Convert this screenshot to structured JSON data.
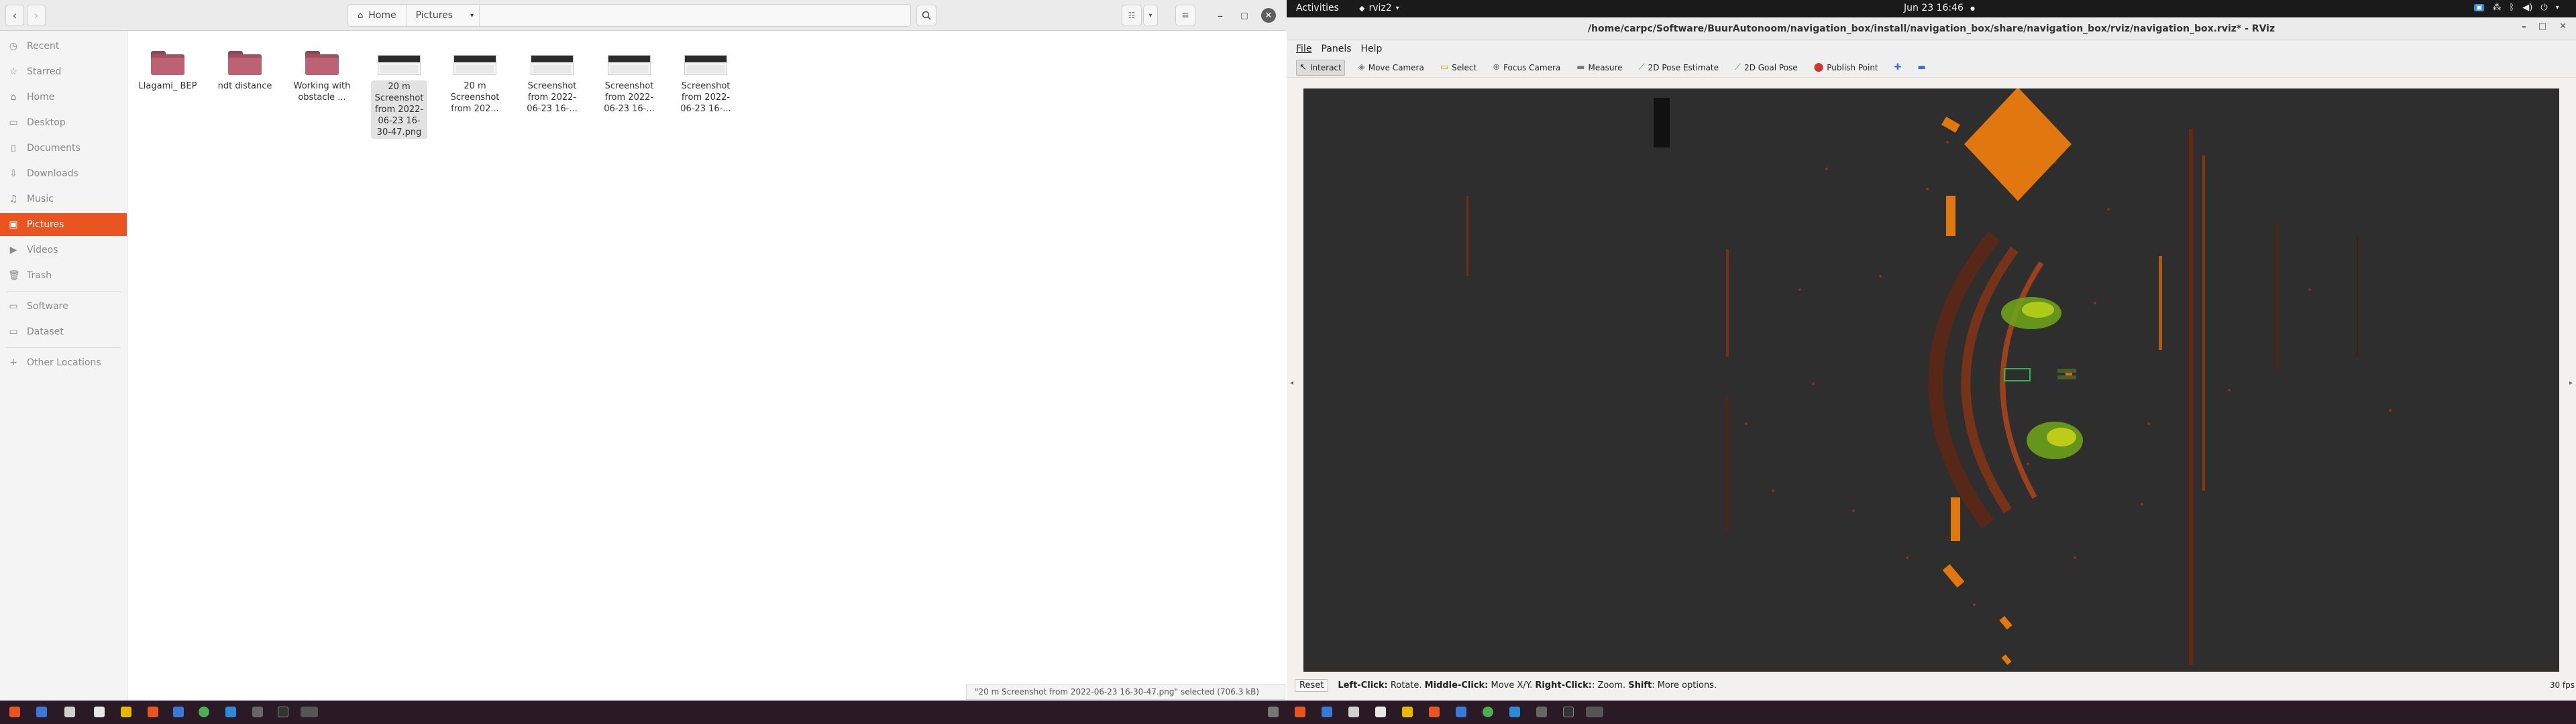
{
  "file_manager": {
    "nav": {
      "back": "‹",
      "forward": "›"
    },
    "path": [
      "Home",
      "Pictures"
    ],
    "sidebar": [
      {
        "label": "Recent",
        "icon": "clock-icon"
      },
      {
        "label": "Starred",
        "icon": "star-icon"
      },
      {
        "label": "Home",
        "icon": "home-icon"
      },
      {
        "label": "Desktop",
        "icon": "desktop-icon"
      },
      {
        "label": "Documents",
        "icon": "document-icon"
      },
      {
        "label": "Downloads",
        "icon": "download-icon"
      },
      {
        "label": "Music",
        "icon": "music-icon"
      },
      {
        "label": "Pictures",
        "icon": "picture-icon",
        "active": true
      },
      {
        "label": "Videos",
        "icon": "video-icon"
      },
      {
        "label": "Trash",
        "icon": "trash-icon"
      },
      {
        "label": "Software",
        "icon": "folder-icon"
      },
      {
        "label": "Dataset",
        "icon": "folder-icon"
      },
      {
        "label": "Other Locations",
        "icon": "plus-icon"
      }
    ],
    "files": [
      {
        "name": "Llagami_ BEP",
        "kind": "folder"
      },
      {
        "name": "ndt distance",
        "kind": "folder"
      },
      {
        "name": "Working with obstacle ...",
        "kind": "folder"
      },
      {
        "name": "20 m Screenshot from 2022-06-23 16-30-47.png",
        "kind": "image",
        "selected": true
      },
      {
        "name": "20 m Screenshot from 202...",
        "kind": "image"
      },
      {
        "name": "Screenshot from 2022-06-23 16-...",
        "kind": "image"
      },
      {
        "name": "Screenshot from 2022-06-23 16-...",
        "kind": "image"
      },
      {
        "name": "Screenshot from 2022-06-23 16-...",
        "kind": "image"
      }
    ],
    "status": "\"20 m Screenshot from 2022-06-23 16-30-47.png\" selected (706.3 kB)"
  },
  "topbar": {
    "activities": "Activities",
    "app": "rviz2",
    "clock": "Jun 23  16:46"
  },
  "rviz": {
    "title": "/home/carpc/Software/BuurAutonoom/navigation_box/install/navigation_box/share/navigation_box/rviz/navigation_box.rviz* - RViz",
    "menu": [
      "File",
      "Panels",
      "Help"
    ],
    "tools": [
      {
        "label": "Interact",
        "icon": "cursor-icon",
        "active": true
      },
      {
        "label": "Move Camera",
        "icon": "camera-move-icon"
      },
      {
        "label": "Select",
        "icon": "select-icon"
      },
      {
        "label": "Focus Camera",
        "icon": "focus-icon"
      },
      {
        "label": "Measure",
        "icon": "ruler-icon"
      },
      {
        "label": "2D Pose Estimate",
        "icon": "pose-estimate-icon"
      },
      {
        "label": "2D Goal Pose",
        "icon": "goal-pose-icon"
      },
      {
        "label": "Publish Point",
        "icon": "publish-point-icon"
      }
    ],
    "status": {
      "reset": "Reset",
      "hint_left_key": "Left-Click:",
      "hint_left": " Rotate. ",
      "hint_middle_key": "Middle-Click:",
      "hint_middle": " Move X/Y. ",
      "hint_right_key": "Right-Click:",
      "hint_right": ": Zoom. ",
      "hint_shift_key": "Shift",
      "hint_shift": ": More options."
    },
    "fps": "30 fps"
  }
}
